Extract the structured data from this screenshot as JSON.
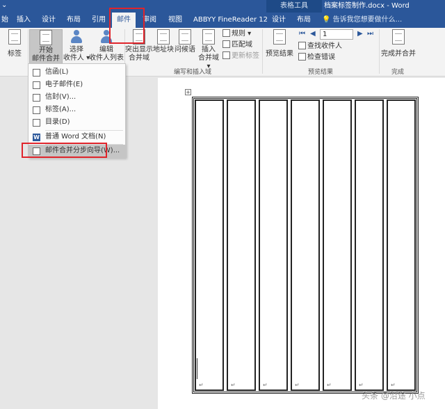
{
  "titlebar": {
    "quick_access": "⌄",
    "context_tools": "表格工具",
    "doc_title": "档案标签制作.docx - Word"
  },
  "tabs": [
    "始",
    "插入",
    "设计",
    "布局",
    "引用",
    "邮件",
    "审阅",
    "视图",
    "ABBYY FineReader 12",
    "设计",
    "布局"
  ],
  "tell_me": "告诉我您想要做什么...",
  "ribbon": {
    "labels_button": "标签",
    "start_merge_line1": "开始",
    "start_merge_line2": "邮件合并 ▾",
    "select_recipients_line1": "选择",
    "select_recipients_line2": "收件人 ▾",
    "edit_list_line1": "编辑",
    "edit_list_line2": "收件人列表",
    "highlight_line1": "突出显示",
    "highlight_line2": "合并域",
    "address_block": "地址块",
    "greeting_line": "问候语",
    "insert_field_line1": "插入",
    "insert_field_line2": "合并域 ▾",
    "rules": "规则 ▾",
    "match_fields": "匹配域",
    "update_labels": "更新标签",
    "group_write_insert": "编写和插入域",
    "preview_results_button": "预览结果",
    "record_number": "1",
    "find_recipient": "查找收件人",
    "check_errors": "检查错误",
    "group_preview": "预览结果",
    "finish_merge": "完成并合并",
    "group_finish": "完成"
  },
  "dropdown": {
    "items": [
      "信函(L)",
      "电子邮件(E)",
      "信封(V)...",
      "标签(A)...",
      "目录(D)",
      "普通 Word 文档(N)",
      "邮件合并分步向导(W)..."
    ]
  },
  "document": {
    "para_mark": "↵",
    "anchor": "+"
  },
  "watermark": "头条 @沿途 小点"
}
